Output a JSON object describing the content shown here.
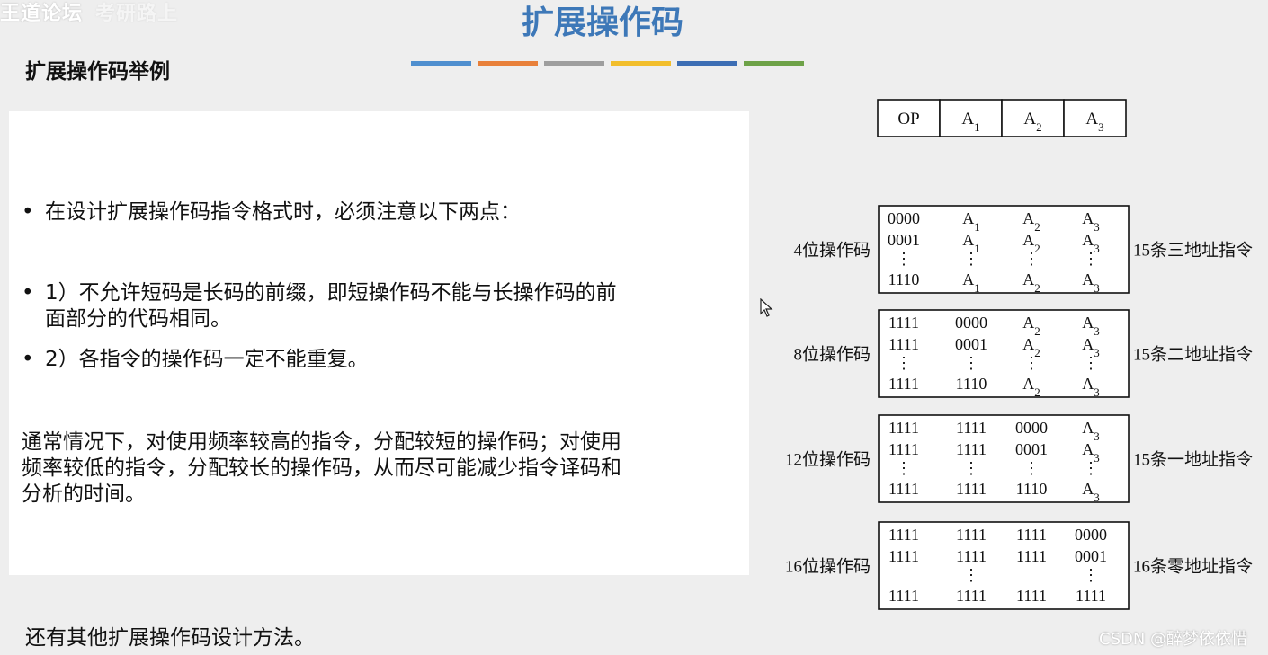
{
  "watermark": {
    "main": "王道论坛",
    "faded": "考研路上"
  },
  "title": "扩展操作码",
  "subtitle": "扩展操作码举例",
  "color_bar_colors": [
    "#4f8fcf",
    "#e8803a",
    "#9e9e9e",
    "#f2be2c",
    "#3d6eb4",
    "#6ea248"
  ],
  "bullets": [
    {
      "dot": "•",
      "lines": [
        "在设计扩展操作码指令格式时，必须注意以下两点："
      ]
    },
    {
      "dot": "•",
      "lines": [
        "1）不允许短码是长码的前缀，即短操作码不能与长操作码的前",
        "面部分的代码相同。"
      ]
    },
    {
      "dot": "•",
      "lines": [
        "2）各指令的操作码一定不能重复。"
      ]
    }
  ],
  "paragraph": [
    "通常情况下，对使用频率较高的指令，分配较短的操作码；对使用",
    "频率较低的指令，分配较长的操作码，从而尽可能减少指令译码和",
    "分析的时间。"
  ],
  "footer": "还有其他扩展操作码设计方法。",
  "format_header": {
    "cells": [
      {
        "main": "OP",
        "sub": ""
      },
      {
        "main": "A",
        "sub": "1"
      },
      {
        "main": "A",
        "sub": "2"
      },
      {
        "main": "A",
        "sub": "3"
      }
    ]
  },
  "groups": [
    {
      "left_label": "4位操作码",
      "right_label": "15条三地址指令",
      "rows": [
        [
          {
            "main": "0000",
            "sub": ""
          },
          {
            "main": "A",
            "sub": "1"
          },
          {
            "main": "A",
            "sub": "2"
          },
          {
            "main": "A",
            "sub": "3"
          }
        ],
        [
          {
            "main": "0001",
            "sub": ""
          },
          {
            "main": "A",
            "sub": "1"
          },
          {
            "main": "A",
            "sub": "2"
          },
          {
            "main": "A",
            "sub": "3"
          }
        ],
        [
          {
            "main": "⋮",
            "sub": ""
          },
          {
            "main": "⋮",
            "sub": ""
          },
          {
            "main": "⋮",
            "sub": ""
          },
          {
            "main": "⋮",
            "sub": ""
          }
        ],
        [
          {
            "main": "1110",
            "sub": ""
          },
          {
            "main": "A",
            "sub": "1"
          },
          {
            "main": "A",
            "sub": "2"
          },
          {
            "main": "A",
            "sub": "3"
          }
        ]
      ]
    },
    {
      "left_label": "8位操作码",
      "right_label": "15条二地址指令",
      "rows": [
        [
          {
            "main": "1111",
            "sub": ""
          },
          {
            "main": "0000",
            "sub": ""
          },
          {
            "main": "A",
            "sub": "2"
          },
          {
            "main": "A",
            "sub": "3"
          }
        ],
        [
          {
            "main": "1111",
            "sub": ""
          },
          {
            "main": "0001",
            "sub": ""
          },
          {
            "main": "A",
            "sub": "2"
          },
          {
            "main": "A",
            "sub": "3"
          }
        ],
        [
          {
            "main": "⋮",
            "sub": ""
          },
          {
            "main": "⋮",
            "sub": ""
          },
          {
            "main": "⋮",
            "sub": ""
          },
          {
            "main": "⋮",
            "sub": ""
          }
        ],
        [
          {
            "main": "1111",
            "sub": ""
          },
          {
            "main": "1110",
            "sub": ""
          },
          {
            "main": "A",
            "sub": "2"
          },
          {
            "main": "A",
            "sub": "3"
          }
        ]
      ]
    },
    {
      "left_label": "12位操作码",
      "right_label": "15条一地址指令",
      "rows": [
        [
          {
            "main": "1111",
            "sub": ""
          },
          {
            "main": "1111",
            "sub": ""
          },
          {
            "main": "0000",
            "sub": ""
          },
          {
            "main": "A",
            "sub": "3"
          }
        ],
        [
          {
            "main": "1111",
            "sub": ""
          },
          {
            "main": "1111",
            "sub": ""
          },
          {
            "main": "0001",
            "sub": ""
          },
          {
            "main": "A",
            "sub": "3"
          }
        ],
        [
          {
            "main": "⋮",
            "sub": ""
          },
          {
            "main": "⋮",
            "sub": ""
          },
          {
            "main": "⋮",
            "sub": ""
          },
          {
            "main": "⋮",
            "sub": ""
          }
        ],
        [
          {
            "main": "1111",
            "sub": ""
          },
          {
            "main": "1111",
            "sub": ""
          },
          {
            "main": "1110",
            "sub": ""
          },
          {
            "main": "A",
            "sub": "3"
          }
        ]
      ]
    },
    {
      "left_label": "16位操作码",
      "right_label": "16条零地址指令",
      "rows": [
        [
          {
            "main": "1111",
            "sub": ""
          },
          {
            "main": "1111",
            "sub": ""
          },
          {
            "main": "1111",
            "sub": ""
          },
          {
            "main": "0000",
            "sub": ""
          }
        ],
        [
          {
            "main": "1111",
            "sub": ""
          },
          {
            "main": "1111",
            "sub": ""
          },
          {
            "main": "1111",
            "sub": ""
          },
          {
            "main": "0001",
            "sub": ""
          }
        ],
        [
          {
            "main": "",
            "sub": ""
          },
          {
            "main": "⋮",
            "sub": ""
          },
          {
            "main": "",
            "sub": ""
          },
          {
            "main": "⋮",
            "sub": ""
          }
        ],
        [
          {
            "main": "1111",
            "sub": ""
          },
          {
            "main": "1111",
            "sub": ""
          },
          {
            "main": "1111",
            "sub": ""
          },
          {
            "main": "1111",
            "sub": ""
          }
        ]
      ]
    }
  ],
  "csdn_watermark": "CSDN @醉梦依依惜"
}
